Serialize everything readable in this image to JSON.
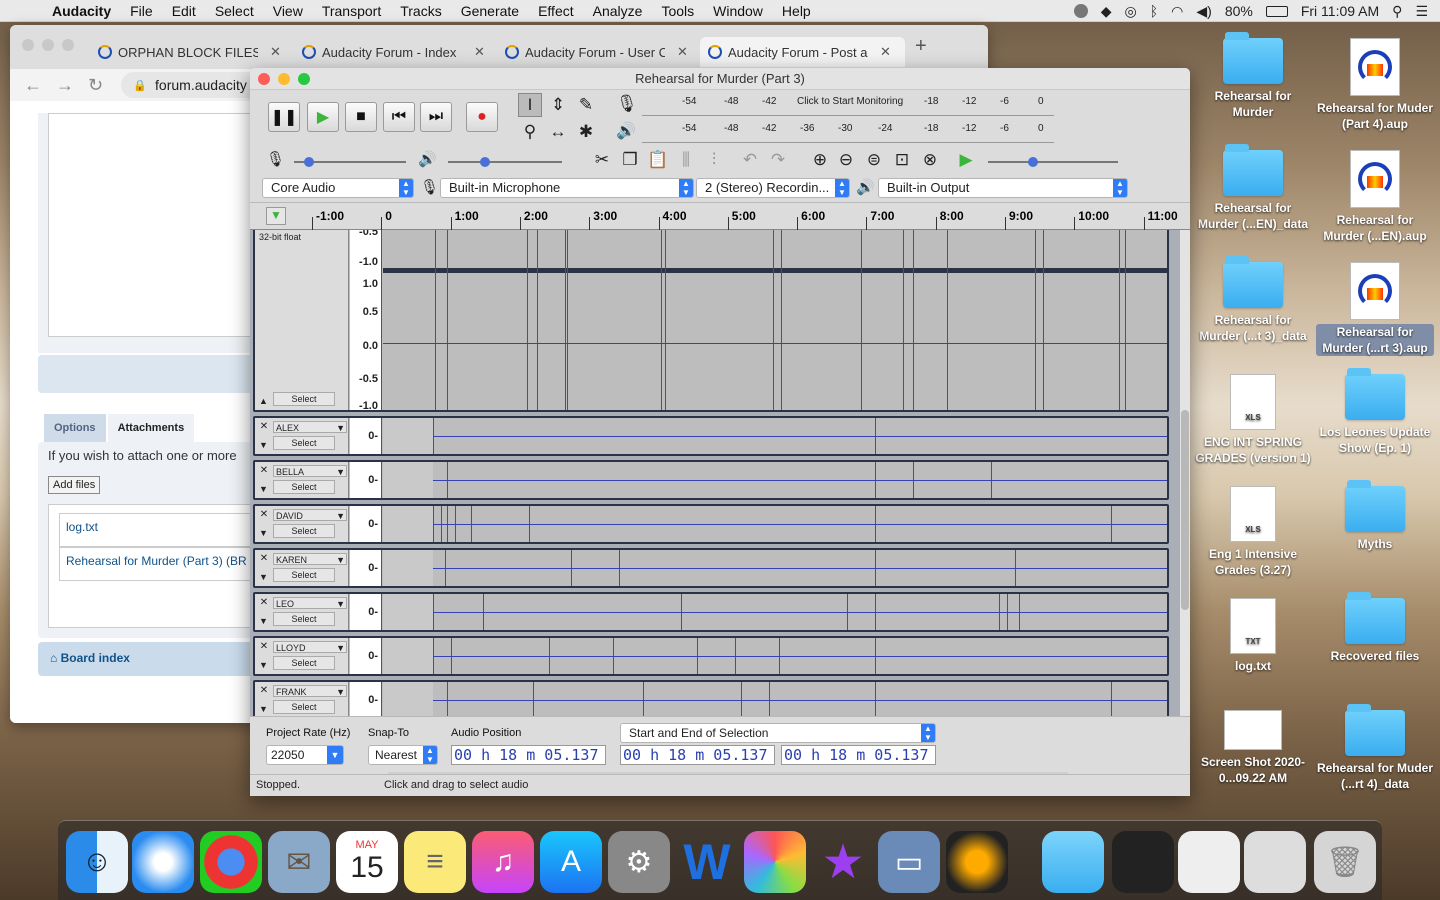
{
  "menubar": {
    "app": "Audacity",
    "items": [
      "File",
      "Edit",
      "Select",
      "View",
      "Transport",
      "Tracks",
      "Generate",
      "Effect",
      "Analyze",
      "Tools",
      "Window",
      "Help"
    ],
    "battery": "80%",
    "clock": "Fri 11:09 AM"
  },
  "browser": {
    "tabs": [
      "ORPHAN BLOCK FILES?!",
      "Audacity Forum - Index",
      "Audacity Forum - User C",
      "Audacity Forum - Post a"
    ],
    "url": "forum.audacity",
    "tab_options": "Options",
    "tab_attachments": "Attachments",
    "attach_text": "If you wish to attach one or more",
    "add_files": "Add files",
    "attach_list": [
      "log.txt",
      "Rehearsal for Murder (Part 3) (BR"
    ],
    "board_index": "Board index"
  },
  "audacity": {
    "title": "Rehearsal for Murder (Part 3)",
    "meter_rec": [
      "-54",
      "-48",
      "-42",
      "Click to Start Monitoring",
      "-18",
      "-12",
      "-6",
      "0"
    ],
    "meter_play": [
      "-54",
      "-48",
      "-42",
      "-36",
      "-30",
      "-24",
      "-18",
      "-12",
      "-6",
      "0"
    ],
    "host": "Core Audio",
    "input": "Built-in Microphone",
    "channels": "2 (Stereo) Recordin...",
    "output": "Built-in Output",
    "ruler": [
      "-1:00",
      "0",
      "1:00",
      "2:00",
      "3:00",
      "4:00",
      "5:00",
      "6:00",
      "7:00",
      "8:00",
      "9:00",
      "10:00",
      "11:00"
    ],
    "first_track": {
      "format": "32-bit float",
      "scale_top": [
        "-0.5",
        "-1.0"
      ],
      "scale": [
        "1.0",
        "0.5",
        "0.0",
        "-0.5",
        "-1.0"
      ],
      "select": "Select"
    },
    "tracks": [
      {
        "name": "ALEX",
        "zero": "0-",
        "select": "Select"
      },
      {
        "name": "BELLA",
        "zero": "0-",
        "select": "Select"
      },
      {
        "name": "DAVID",
        "zero": "0-",
        "select": "Select"
      },
      {
        "name": "KAREN",
        "zero": "0-",
        "select": "Select"
      },
      {
        "name": "LEO",
        "zero": "0-",
        "select": "Select"
      },
      {
        "name": "LLOYD",
        "zero": "0-",
        "select": "Select"
      },
      {
        "name": "FRANK",
        "zero": "0-",
        "select": "Select"
      }
    ],
    "project_rate_label": "Project Rate (Hz)",
    "project_rate": "22050",
    "snap_label": "Snap-To",
    "snap": "Nearest",
    "audio_pos_label": "Audio Position",
    "audio_pos": "00 h 18 m 05.137 s",
    "sel_mode": "Start and End of Selection",
    "sel_start": "00 h 18 m 05.137 s",
    "sel_end": "00 h 18 m 05.137 s",
    "status_left": "Stopped.",
    "status_right": "Click and drag to select audio"
  },
  "desktop": [
    {
      "label": "Rehearsal for Murder",
      "type": "folder"
    },
    {
      "label": "Rehearsal for Muder (Part 4).aup",
      "type": "aup"
    },
    {
      "label": "Rehearsal for Murder (...EN)_data",
      "type": "folder"
    },
    {
      "label": "Rehearsal for Murder (...EN).aup",
      "type": "aup"
    },
    {
      "label": "Rehearsal for Murder (...t 3)_data",
      "type": "folder"
    },
    {
      "label": "Rehearsal for Murder (...rt 3).aup",
      "type": "aup"
    },
    {
      "label": "ENG INT SPRING GRADES (version 1)",
      "type": "xls"
    },
    {
      "label": "Los Leones Update Show (Ep. 1)",
      "type": "folder"
    },
    {
      "label": "Eng 1 Intensive Grades (3.27)",
      "type": "xls"
    },
    {
      "label": "Myths",
      "type": "folder"
    },
    {
      "label": "log.txt",
      "type": "txt"
    },
    {
      "label": "Recovered files",
      "type": "folder"
    },
    {
      "label": "Screen Shot 2020-0...09.22 AM",
      "type": "shot"
    },
    {
      "label": "Rehearsal for Muder (...rt 4)_data",
      "type": "folder"
    }
  ],
  "dock": {
    "calendar_month": "MAY",
    "calendar_day": "15"
  }
}
